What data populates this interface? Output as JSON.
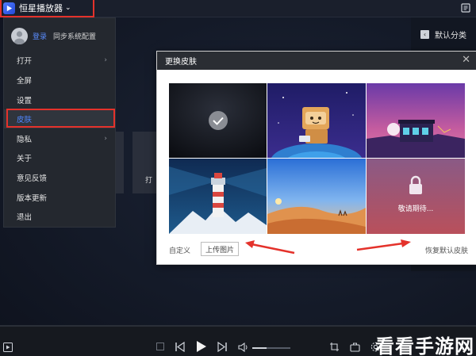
{
  "app": {
    "title": "恒星播放器",
    "logo_icon": "play-logo-icon"
  },
  "right_panel": {
    "category_label": "默认分类"
  },
  "background": {
    "tile_label": "打"
  },
  "menu": {
    "login": "登录",
    "sync": "同步系统配置",
    "items": [
      {
        "label": "打开",
        "has_submenu": true
      },
      {
        "label": "全屏",
        "has_submenu": false
      },
      {
        "label": "设置",
        "has_submenu": false
      },
      {
        "label": "皮肤",
        "has_submenu": false,
        "active": true
      },
      {
        "label": "隐私",
        "has_submenu": true
      },
      {
        "label": "关于",
        "has_submenu": false
      },
      {
        "label": "意见反馈",
        "has_submenu": false
      },
      {
        "label": "版本更新",
        "has_submenu": false
      },
      {
        "label": "退出",
        "has_submenu": false
      }
    ]
  },
  "dialog": {
    "title": "更换皮肤",
    "skins": [
      {
        "name": "default-dark",
        "selected": true
      },
      {
        "name": "cardboard-astronaut",
        "selected": false
      },
      {
        "name": "purple-night-house",
        "selected": false
      },
      {
        "name": "lighthouse",
        "selected": false
      },
      {
        "name": "desert",
        "selected": false
      },
      {
        "name": "locked",
        "locked": true,
        "label": "敬请期待..."
      }
    ],
    "custom_label": "自定义",
    "upload_button": "上传图片",
    "restore_link": "恢复默认皮肤"
  },
  "watermark": "看看手游网",
  "colors": {
    "highlight_red": "#e4322b",
    "accent_blue": "#4f86ff"
  }
}
